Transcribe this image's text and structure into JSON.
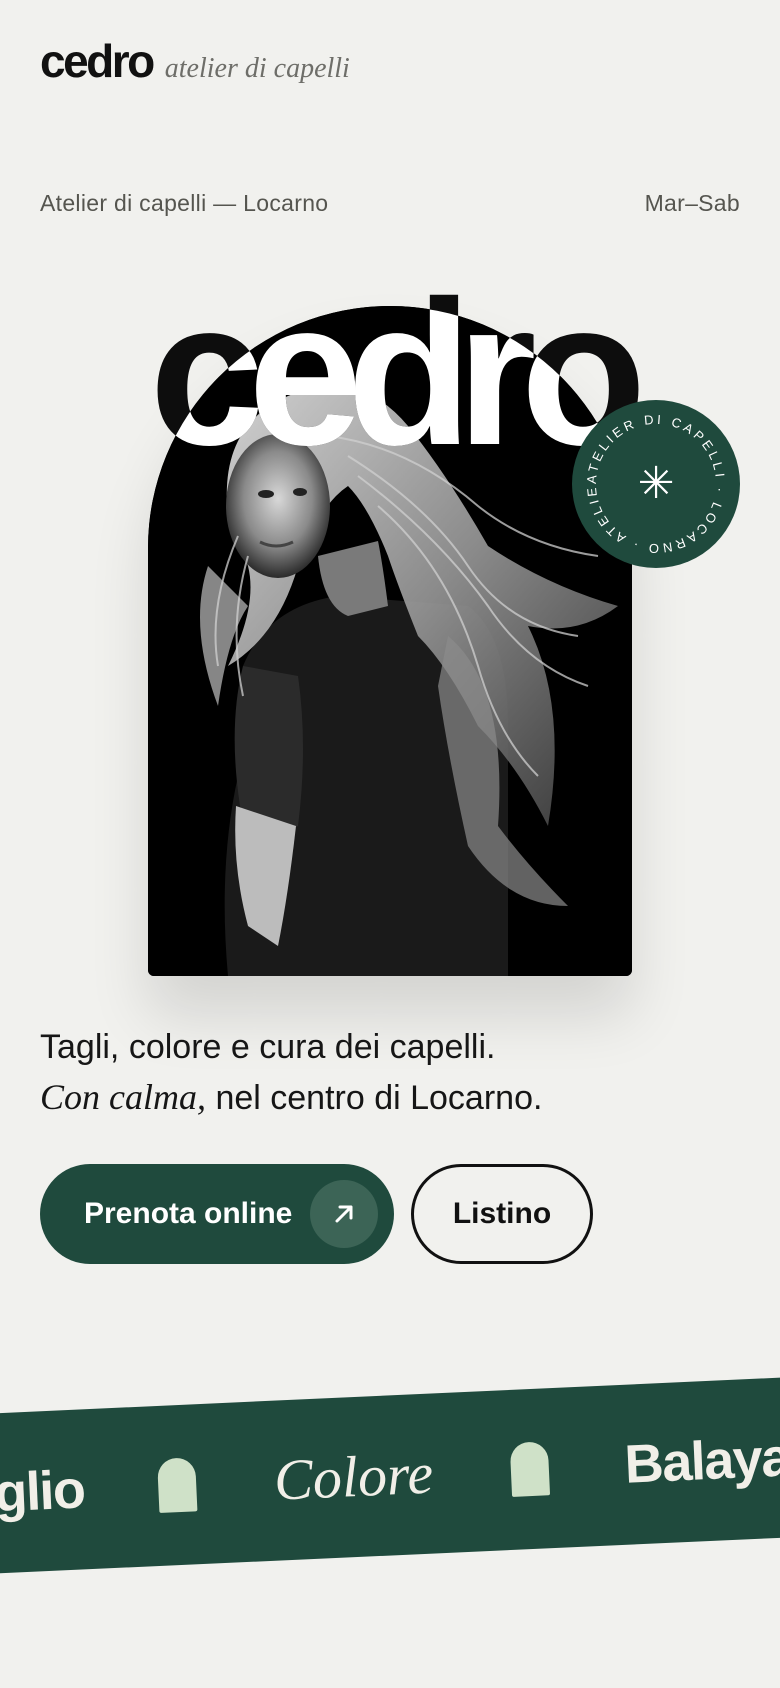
{
  "header": {
    "brand_name": "cedro",
    "brand_tagline": "atelier di capelli"
  },
  "meta": {
    "location": "Atelier di capelli — Locarno",
    "hours": "Mar–Sab"
  },
  "hero": {
    "wordmark": "cedro",
    "badge_text": "ATELIER DI CAPELLI · LOCARNO · ATELIER ·",
    "badge_symbol": "✳"
  },
  "headline": {
    "line1": "Tagli, colore e cura dei capelli.",
    "line2_italic": "Con calma,",
    "line2_rest": " nel centro di Locarno."
  },
  "cta": {
    "primary_label": "Prenota online",
    "secondary_label": "Listino"
  },
  "marquee": {
    "items": [
      "Taglio",
      "Colore",
      "Balayage"
    ]
  },
  "colors": {
    "background": "#f1f1ee",
    "accent_green": "#1f4a3d",
    "arch_mint": "#cfe1c8"
  }
}
